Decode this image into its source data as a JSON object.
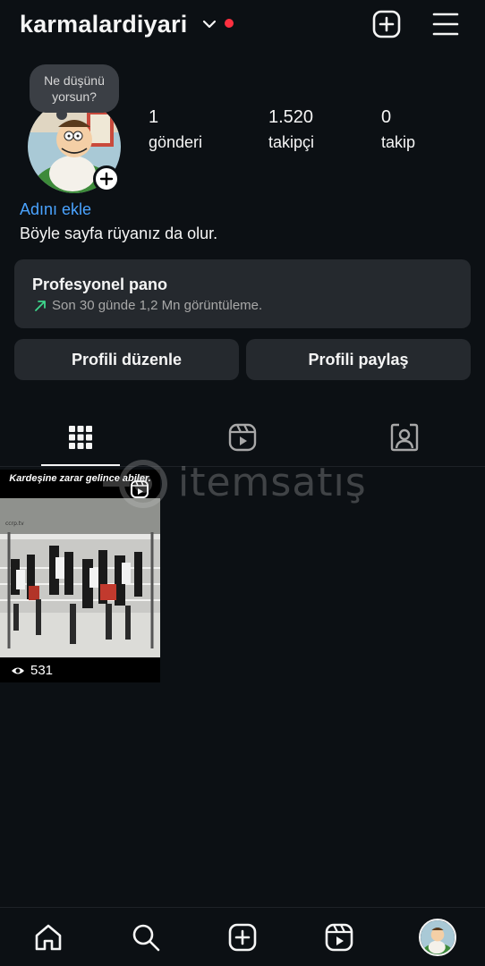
{
  "header": {
    "username": "karmalardiyari",
    "icons": [
      "chevron-down-icon",
      "create-icon",
      "menu-icon"
    ],
    "colors": {
      "notification_dot": "#ff3040",
      "link": "#4aa3ff"
    }
  },
  "profile": {
    "note": "Ne düşünü yorsun?",
    "stats": [
      {
        "value": "1",
        "label": "gönderi"
      },
      {
        "value": "1.520",
        "label": "takipçi"
      },
      {
        "value": "0",
        "label": "takip"
      }
    ],
    "add_name": "Adını ekle",
    "bio": "Böyle sayfa rüyanız da olur."
  },
  "professional": {
    "title": "Profesyonel pano",
    "subtitle": "Son 30 günde 1,2 Mn görüntüleme."
  },
  "buttons": {
    "edit": "Profili düzenle",
    "share": "Profili paylaş"
  },
  "tabs": [
    "grid-icon",
    "reels-icon",
    "tagged-icon"
  ],
  "posts": [
    {
      "caption": "Kardeşine zarar gelince abiler.",
      "views": "531"
    }
  ],
  "watermark": "itemsatış",
  "bottom_nav": [
    "home-icon",
    "search-icon",
    "create-icon",
    "reels-icon",
    "profile-avatar"
  ]
}
